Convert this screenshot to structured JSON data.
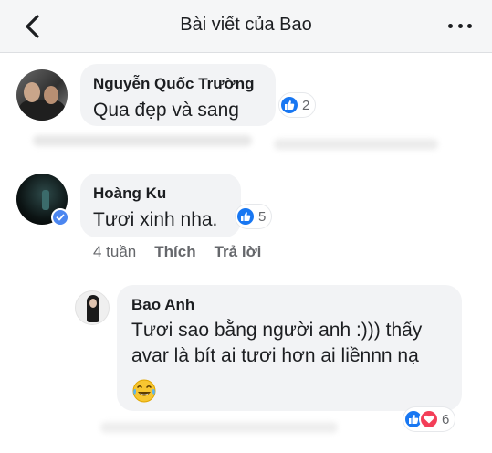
{
  "header": {
    "title": "Bài viết của Bao"
  },
  "comments": [
    {
      "author": "Nguyễn Quốc Trường",
      "text": "Qua đẹp và sang",
      "likes": "2"
    },
    {
      "author": "Hoàng Ku",
      "text": "Tươi xinh nha.",
      "likes": "5",
      "verified": true,
      "meta": {
        "time": "4 tuần",
        "like": "Thích",
        "reply": "Trả lời"
      }
    }
  ],
  "reply": {
    "author": "Bao Anh",
    "text": "Tươi sao bằng người anh :))) thấy avar là bít ai tươi hơn ai liềnnn nạ",
    "emoji": "laughing-tears",
    "reactions": "6"
  },
  "colors": {
    "like": "#1877f2",
    "love": "#f33e58",
    "bubble": "#f2f3f5",
    "verified": "#4b86f0"
  }
}
